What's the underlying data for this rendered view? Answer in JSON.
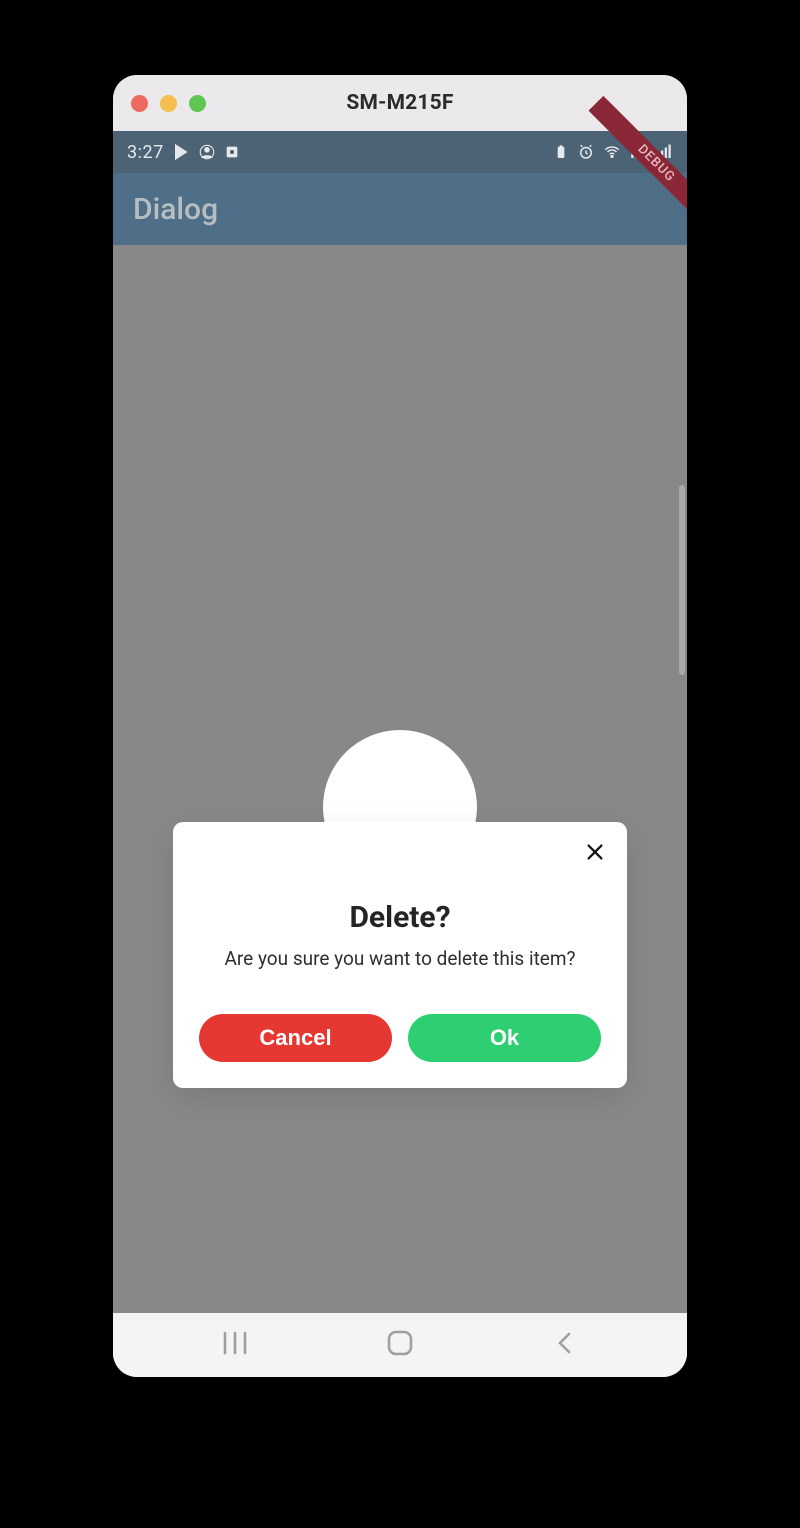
{
  "window": {
    "title": "SM-M215F"
  },
  "status": {
    "time": "3:27"
  },
  "debug_banner": "DEBUG",
  "appbar": {
    "title": "Dialog"
  },
  "dialog": {
    "title": "Delete?",
    "message": "Are you sure you want to delete this item?",
    "cancel_label": "Cancel",
    "ok_label": "Ok"
  },
  "colors": {
    "cancel": "#e53832",
    "ok": "#2ecf72",
    "status_bg": "#1a4664",
    "appbar_bg": "#205a86"
  }
}
